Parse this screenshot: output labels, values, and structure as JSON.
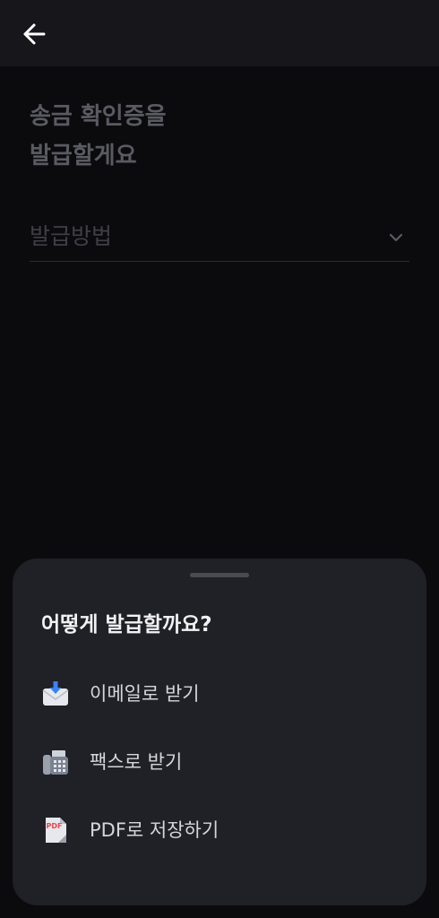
{
  "header": {
    "back_icon": "arrow-left-icon"
  },
  "page": {
    "title_line1": "송금 확인증을",
    "title_line2": "발급할게요",
    "method_placeholder": "발급방법",
    "chevron_icon": "chevron-down-icon"
  },
  "sheet": {
    "title": "어떻게 발급할까요?",
    "options": [
      {
        "label": "이메일로 받기",
        "icon": "email-icon"
      },
      {
        "label": "팩스로 받기",
        "icon": "fax-icon"
      },
      {
        "label": "PDF로 저장하기",
        "icon": "pdf-icon",
        "badge": "PDF"
      }
    ]
  },
  "colors": {
    "background": "#0b0b0d",
    "topbar": "#17171b",
    "sheet": "#202027",
    "pdf_red": "#e5484d",
    "mail_blue": "#3b82f6"
  }
}
